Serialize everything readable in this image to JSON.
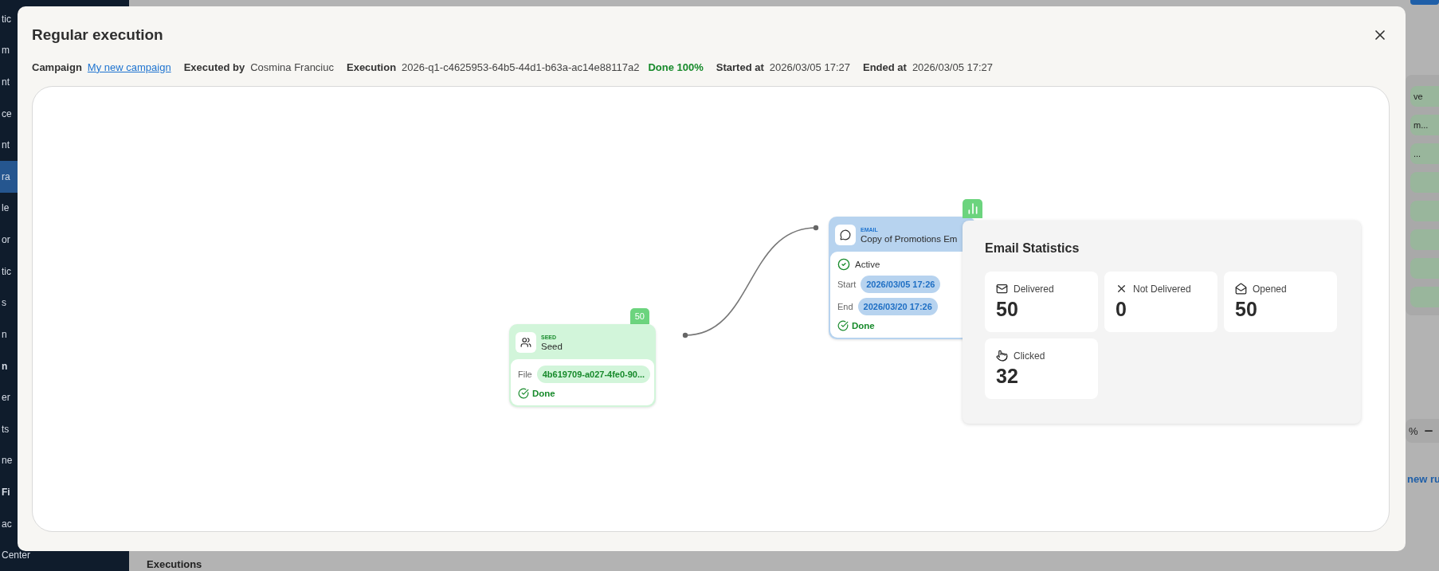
{
  "background": {
    "sidebar": [
      {
        "label": "tic",
        "kind": "item",
        "selected": false
      },
      {
        "label": "m",
        "kind": "item",
        "selected": false
      },
      {
        "label": "nt",
        "kind": "item",
        "selected": false
      },
      {
        "label": "ce",
        "kind": "item",
        "selected": false
      },
      {
        "label": "nt",
        "kind": "item",
        "selected": false
      },
      {
        "label": "ra",
        "kind": "item",
        "selected": true
      },
      {
        "label": "le",
        "kind": "item",
        "selected": false
      },
      {
        "label": "or",
        "kind": "item",
        "selected": false
      },
      {
        "label": "tic",
        "kind": "item",
        "selected": false
      },
      {
        "label": "s",
        "kind": "item",
        "selected": false
      },
      {
        "label": "n",
        "kind": "item",
        "selected": false
      },
      {
        "label": "n",
        "kind": "header",
        "selected": false
      },
      {
        "label": "er",
        "kind": "item",
        "selected": false
      },
      {
        "label": "ts",
        "kind": "item",
        "selected": false
      },
      {
        "label": "ne",
        "kind": "item",
        "selected": false
      },
      {
        "label": "Fi",
        "kind": "header",
        "selected": false
      },
      {
        "label": "ac",
        "kind": "item",
        "selected": false
      },
      {
        "label": "Center",
        "kind": "item",
        "selected": false
      }
    ],
    "right_pills": [
      "ve",
      "m...",
      "..."
    ],
    "zoom_reading": "%",
    "link": "new ru",
    "section_title": "Executions"
  },
  "modal": {
    "title": "Regular execution",
    "meta": [
      {
        "label": "Campaign",
        "value": "My new campaign",
        "kind": "link"
      },
      {
        "label": "Executed by",
        "value": "Cosmina Franciuc",
        "kind": "text"
      },
      {
        "label": "Execution",
        "value": "2026-q1-c4625953-64b5-44d1-b63a-ac14e88117a2",
        "status": "Done 100%",
        "kind": "text"
      },
      {
        "label": "Started at",
        "value": "2026/03/05 17:27",
        "kind": "text"
      },
      {
        "label": "Ended at",
        "value": "2026/03/05 17:27",
        "kind": "text"
      }
    ],
    "nodes": [
      {
        "kind": "seed",
        "type_label": "SEED",
        "title": "Seed",
        "count": "50",
        "fields": [
          {
            "label": "File",
            "value": "4b619709-a027-4fe0-90..."
          }
        ],
        "status": "Done"
      },
      {
        "kind": "email",
        "type_label": "EMAIL",
        "title": "Copy of Promotions Em",
        "state": "Active",
        "fields": [
          {
            "label": "Start",
            "value": "2026/03/05 17:26"
          },
          {
            "label": "End",
            "value": "2026/03/20 17:26"
          }
        ],
        "status": "Done"
      }
    ],
    "stats": {
      "title": "Email Statistics",
      "cards": [
        {
          "kind": "delivered",
          "label": "Delivered",
          "value": "50"
        },
        {
          "kind": "not_delivered",
          "label": "Not Delivered",
          "value": "0"
        },
        {
          "kind": "opened",
          "label": "Opened",
          "value": "50"
        },
        {
          "kind": "clicked",
          "label": "Clicked",
          "value": "32"
        }
      ]
    }
  }
}
